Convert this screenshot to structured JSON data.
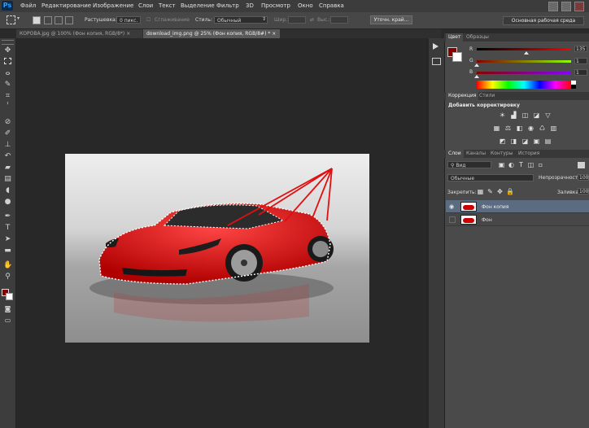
{
  "app": {
    "logo": "Ps"
  },
  "menu": [
    "Файл",
    "Редактирование",
    "Изображение",
    "Слои",
    "Текст",
    "Выделение",
    "Фильтр",
    "3D",
    "Просмотр",
    "Окно",
    "Справка"
  ],
  "options": {
    "feather_label": "Растушевка:",
    "feather_value": "0 пикс.",
    "antialias_label": "Сглаживание",
    "style_label": "Стиль:",
    "style_value": "Обычный",
    "width_label": "Шир.:",
    "height_label": "Выс.:",
    "refine_button": "Уточн. край...",
    "workspace": "Основная рабочая среда"
  },
  "tabs": [
    {
      "label": "КОРОВА.jpg @ 100% (Фон копия, RGB/8*)",
      "close": "×",
      "active": false
    },
    {
      "label": "download_img.png @ 25% (Фон копия, RGB/8#) *",
      "close": "×",
      "active": true
    }
  ],
  "color_panel": {
    "tabs": [
      "Цвет",
      "Образцы"
    ],
    "channels": [
      {
        "letter": "R",
        "value": "135",
        "thumb": 0.53
      },
      {
        "letter": "G",
        "value": "1",
        "thumb": 0.0
      },
      {
        "letter": "B",
        "value": "1",
        "thumb": 0.0
      }
    ],
    "fg_color": "#870101",
    "bg_color": "#ffffff"
  },
  "adjust_panel": {
    "tabs": [
      "Коррекция",
      "Стили"
    ],
    "title": "Добавить корректировку"
  },
  "layers_panel": {
    "tabs": [
      "Слои",
      "Каналы",
      "Контуры",
      "История"
    ],
    "kind": "Вид",
    "blend_mode": "Обычные",
    "opacity_label": "Непрозрачность:",
    "opacity_value": "100",
    "lock_label": "Закрепить:",
    "fill_label": "Заливка:",
    "fill_value": "100",
    "layers": [
      {
        "name": "Фон копия",
        "selected": true
      },
      {
        "name": "Фон",
        "selected": false
      }
    ]
  },
  "colors": {
    "accent_red": "#e01010",
    "selected_layer": "#5b6b80"
  }
}
